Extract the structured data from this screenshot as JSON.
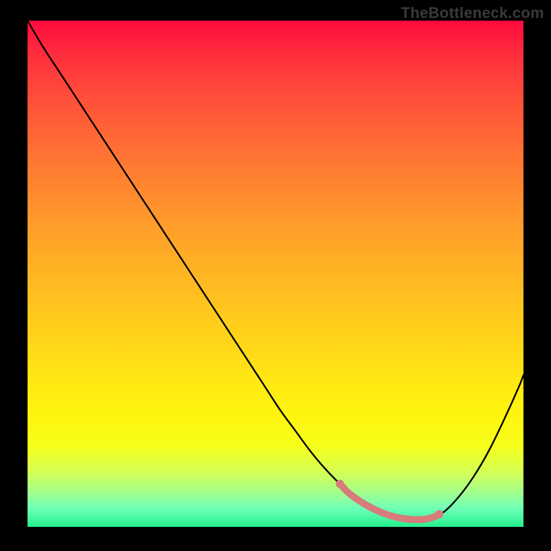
{
  "watermark": "TheBottleneck.com",
  "chart_data": {
    "type": "line",
    "title": "",
    "xlabel": "",
    "ylabel": "",
    "xlim": [
      0,
      100
    ],
    "ylim": [
      0,
      100
    ],
    "grid": false,
    "legend": false,
    "series": [
      {
        "name": "bottleneck-curve",
        "color": "#000000",
        "x": [
          0,
          3,
          6,
          9,
          12,
          15,
          18,
          21,
          24,
          27,
          30,
          33,
          36,
          39,
          42,
          45,
          48,
          51,
          54,
          57,
          60,
          63,
          66,
          69,
          72,
          75,
          78,
          81,
          84,
          87,
          90,
          93,
          96,
          99,
          100
        ],
        "values": [
          100,
          95,
          90.5,
          86,
          81.5,
          77,
          72.5,
          68,
          63.5,
          59,
          54.5,
          50,
          45.5,
          41,
          36.5,
          32,
          27.5,
          23,
          19,
          15,
          11.5,
          8.5,
          6,
          4,
          2.5,
          1.5,
          1,
          1.5,
          3,
          6,
          10,
          15,
          21,
          27.5,
          30
        ]
      },
      {
        "name": "low-bottleneck-range",
        "color": "#d87b7b",
        "x": [
          63,
          65,
          68,
          71,
          74,
          77,
          80,
          82,
          83
        ],
        "values": [
          8.5,
          6.5,
          4.5,
          3,
          2,
          1.5,
          1.5,
          2,
          2.5
        ]
      }
    ],
    "annotations": [
      {
        "type": "point",
        "name": "range-start",
        "x": 63,
        "y": 8.5,
        "color": "#d87b7b"
      },
      {
        "type": "point",
        "name": "range-end",
        "x": 83,
        "y": 2.5,
        "color": "#d87b7b"
      }
    ],
    "background_gradient": {
      "direction": "vertical",
      "stops": [
        {
          "pos": 0.0,
          "color": "#ff0a3c"
        },
        {
          "pos": 0.5,
          "color": "#ffbf20"
        },
        {
          "pos": 0.85,
          "color": "#fff50e"
        },
        {
          "pos": 1.0,
          "color": "#24f08e"
        }
      ]
    }
  }
}
